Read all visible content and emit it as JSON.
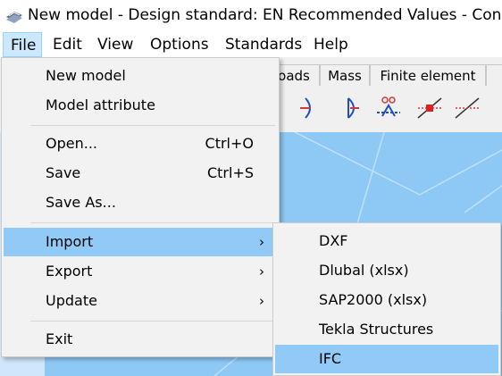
{
  "window": {
    "title": "New model - Design standard: EN Recommended Values - ConSteel"
  },
  "menubar": {
    "items": [
      {
        "label": "File"
      },
      {
        "label": "Edit"
      },
      {
        "label": "View"
      },
      {
        "label": "Options"
      },
      {
        "label": "Standards"
      },
      {
        "label": "Help"
      }
    ]
  },
  "tabs": [
    {
      "label": "oads"
    },
    {
      "label": "Mass"
    },
    {
      "label": "Finite element"
    }
  ],
  "file_menu": {
    "items": [
      {
        "label": "New model",
        "shortcut": ""
      },
      {
        "label": "Model attribute",
        "shortcut": ""
      },
      {
        "label": "Open...",
        "shortcut": "Ctrl+O"
      },
      {
        "label": "Save",
        "shortcut": "Ctrl+S"
      },
      {
        "label": "Save As...",
        "shortcut": ""
      },
      {
        "label": "Import",
        "shortcut": "",
        "arrow": "›"
      },
      {
        "label": "Export",
        "shortcut": "",
        "arrow": "›"
      },
      {
        "label": "Update",
        "shortcut": "",
        "arrow": "›"
      },
      {
        "label": "Exit",
        "shortcut": ""
      }
    ]
  },
  "import_submenu": {
    "items": [
      {
        "label": "DXF"
      },
      {
        "label": "Dlubal (xlsx)"
      },
      {
        "label": "SAP2000 (xlsx)"
      },
      {
        "label": "Tekla Structures"
      },
      {
        "label": "IFC"
      }
    ]
  },
  "colors": {
    "menu_highlight": "#91c9f7",
    "active_top_menu": "#cce8ff",
    "canvas": "#8ec9f6"
  },
  "icons": {
    "app": "consteel-app-icon"
  }
}
